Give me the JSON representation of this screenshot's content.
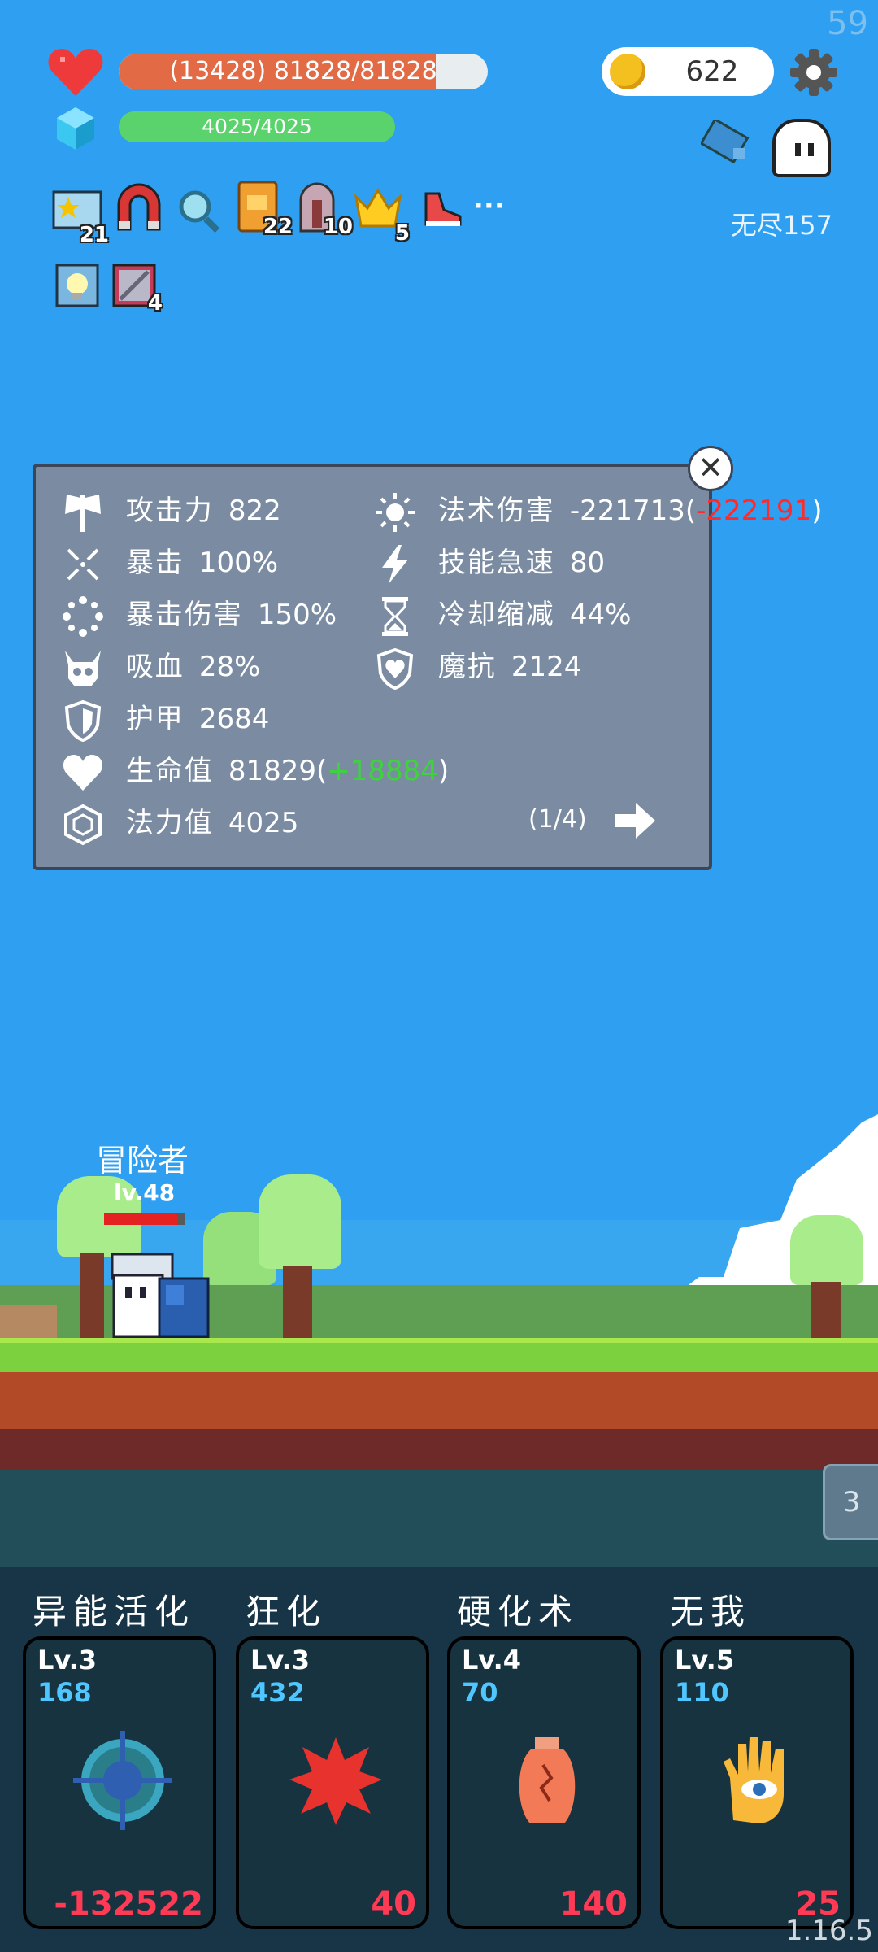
{
  "fps": "59",
  "version": "1.16.5",
  "hud": {
    "hp_text": "(13428) 81828/81828",
    "hp_fill_fraction": 0.86,
    "mp_text": "4025/4025",
    "coins": "622",
    "endless_label": "无尽157"
  },
  "buffs": [
    {
      "icon": "star-card-icon",
      "count": "21"
    },
    {
      "icon": "magnet-icon",
      "count": ""
    },
    {
      "icon": "magnifier-icon",
      "count": ""
    },
    {
      "icon": "book-icon",
      "count": "22"
    },
    {
      "icon": "tombstone-icon",
      "count": "10"
    },
    {
      "icon": "crown-icon",
      "count": "5"
    },
    {
      "icon": "shoe-icon",
      "count": ""
    },
    {
      "icon": "more-icon",
      "count": "···"
    }
  ],
  "buffs_row2": [
    {
      "icon": "lightbulb-icon",
      "count": ""
    },
    {
      "icon": "scroll-icon",
      "count": "4"
    }
  ],
  "stats": {
    "attack": {
      "label": "攻击力",
      "value": "822"
    },
    "crit": {
      "label": "暴击",
      "value": "100%"
    },
    "crit_damage": {
      "label": "暴击伤害",
      "value": "150%"
    },
    "lifesteal": {
      "label": "吸血",
      "value": "28%"
    },
    "armor": {
      "label": "护甲",
      "value": "2684"
    },
    "hp": {
      "label": "生命值",
      "value": "81829",
      "bonus": "+18884"
    },
    "mana": {
      "label": "法力值",
      "value": "4025"
    },
    "spell_damage": {
      "label": "法术伤害",
      "value": "-221713",
      "bonus": "-222191"
    },
    "haste": {
      "label": "技能急速",
      "value": "80"
    },
    "cooldown": {
      "label": "冷却缩减",
      "value": "44%"
    },
    "magic_resist": {
      "label": "魔抗",
      "value": "2124"
    },
    "page": "(1/4)"
  },
  "scene": {
    "adventurer_name": "冒险者",
    "adventurer_level": "lv.48",
    "wave_tab": "3"
  },
  "skills": [
    {
      "name": "异能活化",
      "level": "Lv.3",
      "cost": "168",
      "value": "-132522",
      "icon": "crosshair-icon"
    },
    {
      "name": "狂化",
      "level": "Lv.3",
      "cost": "432",
      "value": "40",
      "icon": "blood-splat-icon"
    },
    {
      "name": "硬化术",
      "level": "Lv.4",
      "cost": "70",
      "value": "140",
      "icon": "cracked-vase-icon"
    },
    {
      "name": "无我",
      "level": "Lv.5",
      "cost": "110",
      "value": "25",
      "icon": "eye-hand-icon"
    }
  ],
  "colors": {
    "sky": "#2f9ff2",
    "hp": "#e26a45",
    "mp": "#5ad36c",
    "panel": "#7b8ca2",
    "skill_cost": "#4fc6ff",
    "skill_value": "#ff3a55"
  }
}
